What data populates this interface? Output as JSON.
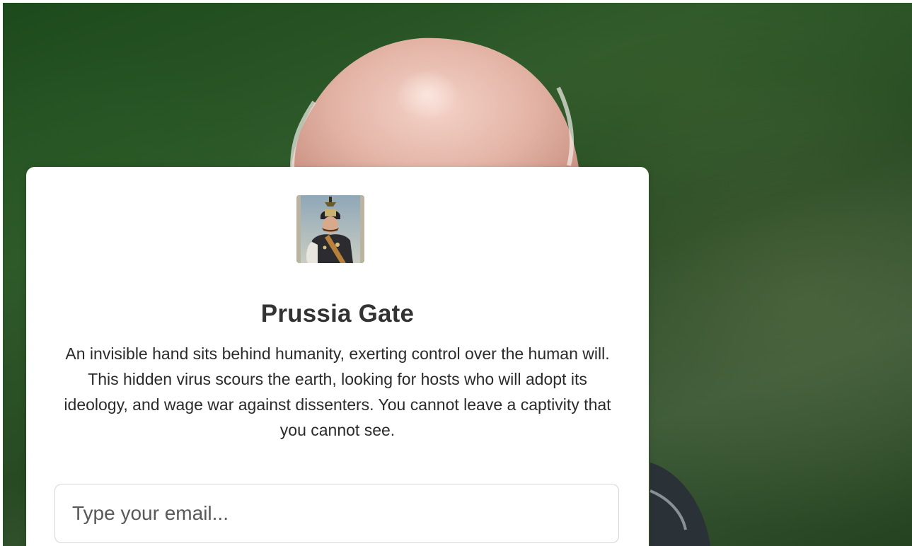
{
  "publication": {
    "title": "Prussia Gate",
    "description": "An invisible hand sits behind humanity, exerting control over the human will. This hidden virus scours the earth, looking for hosts who will adopt its ideology, and wage war against dissenters. You cannot leave a captivity that you cannot see.",
    "logo_icon": "publication-logo-portrait"
  },
  "subscribe": {
    "email_placeholder": "Type your email..."
  },
  "colors": {
    "background_green": "#2f5a2a",
    "card_background": "#ffffff",
    "title_text": "#333333"
  }
}
